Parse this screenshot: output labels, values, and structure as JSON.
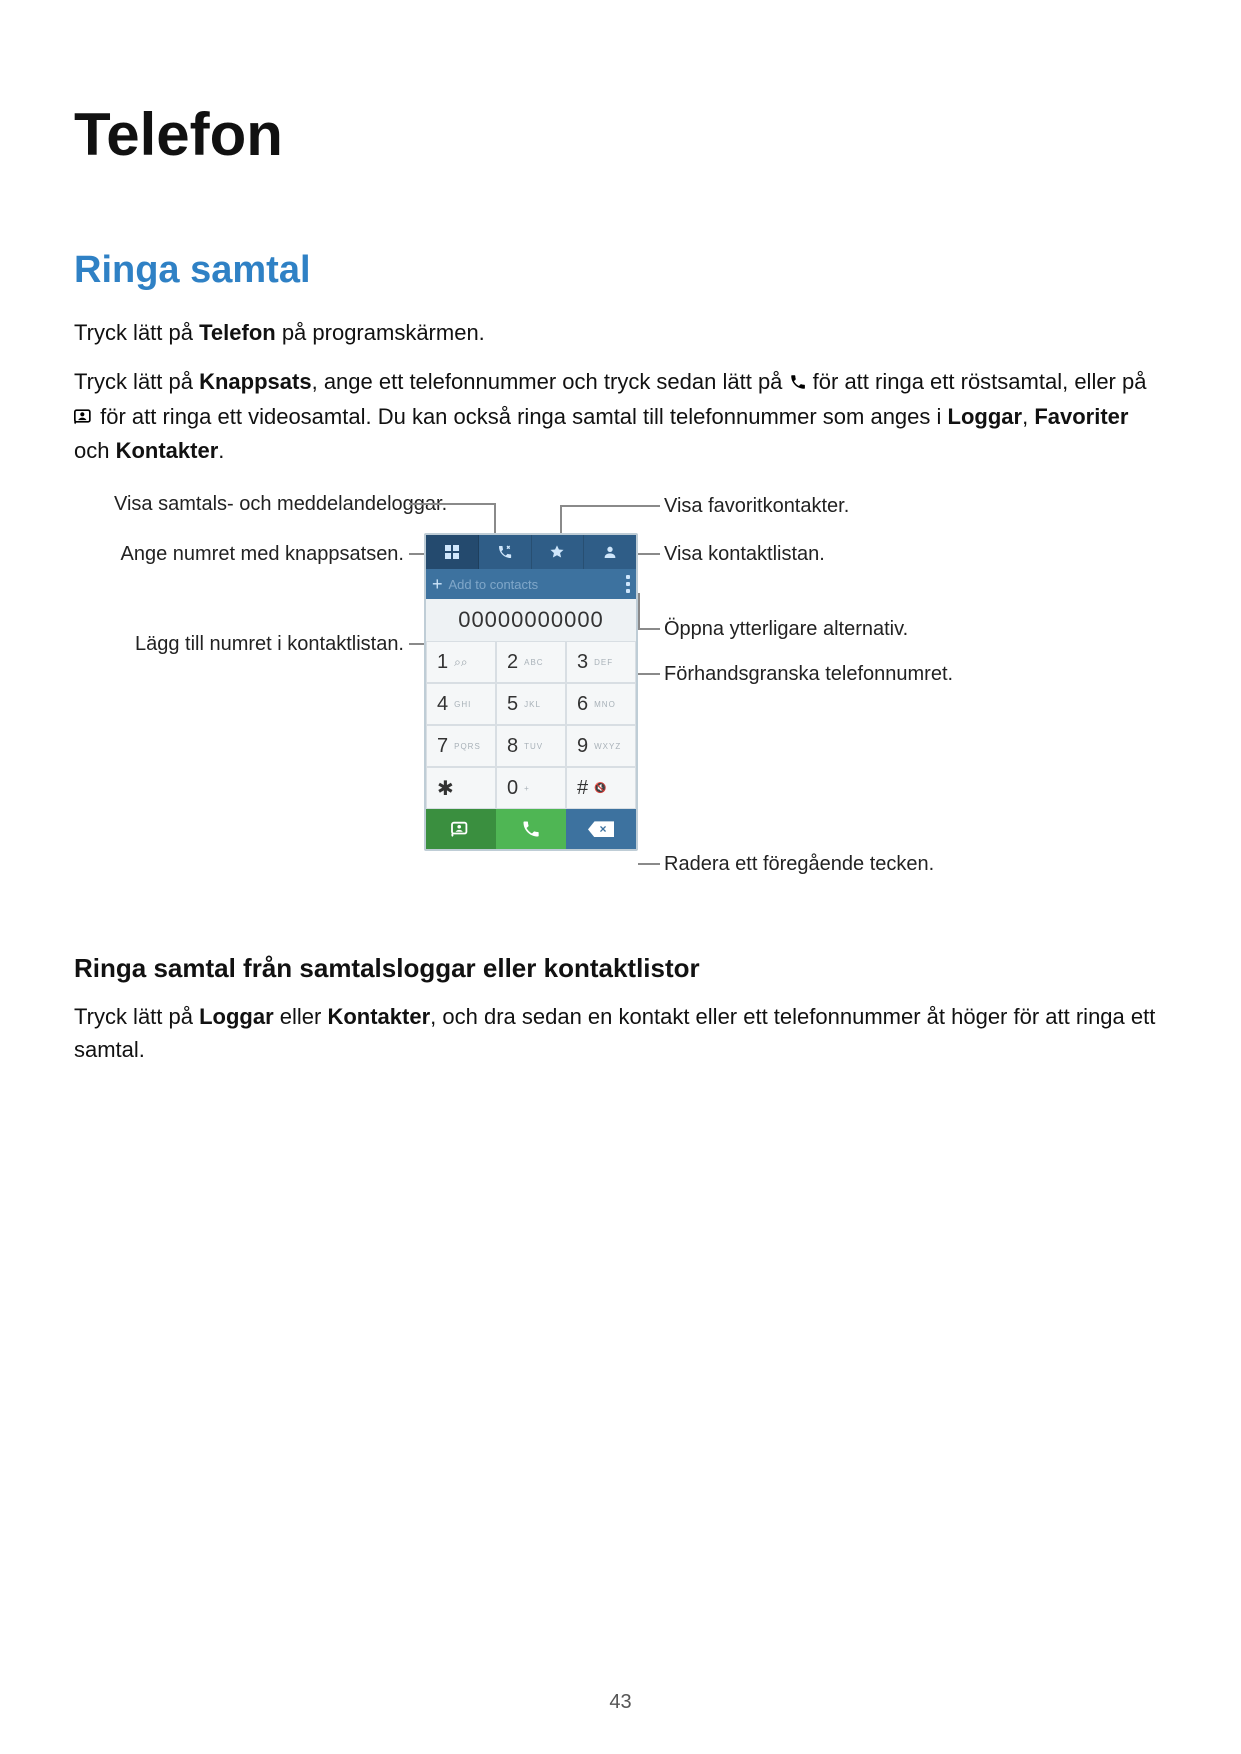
{
  "title": "Telefon",
  "section_heading": "Ringa samtal",
  "intro": {
    "line1_pre": "Tryck lätt på ",
    "line1_b": "Telefon",
    "line1_post": " på programskärmen.",
    "p2_a": "Tryck lätt på ",
    "p2_b1": "Knappsats",
    "p2_c": ", ange ett telefonnummer och tryck sedan lätt på ",
    "p2_d": " för att ringa ett röstsamtal, eller på ",
    "p2_e": " för att ringa ett videosamtal. Du kan också ringa samtal till telefonnummer som anges i ",
    "p2_b2": "Loggar",
    "p2_f": ", ",
    "p2_b3": "Favoriter",
    "p2_g": " och ",
    "p2_b4": "Kontakter",
    "p2_h": "."
  },
  "callouts": {
    "logs": "Visa samtals- och meddelandeloggar.",
    "keypad": "Ange numret med knappsatsen.",
    "add_contact": "Lägg till numret i kontaktlistan.",
    "favorites": "Visa favoritkontakter.",
    "contacts": "Visa kontaktlistan.",
    "menu": "Öppna ytterligare alternativ.",
    "preview": "Förhandsgranska telefonnumret.",
    "backspace": "Radera ett föregående tecken."
  },
  "phone": {
    "add_to_contacts": "Add to contacts",
    "number": "00000000000",
    "keys": [
      {
        "d": "1",
        "s": ""
      },
      {
        "d": "2",
        "s": "ABC"
      },
      {
        "d": "3",
        "s": "DEF"
      },
      {
        "d": "4",
        "s": "GHI"
      },
      {
        "d": "5",
        "s": "JKL"
      },
      {
        "d": "6",
        "s": "MNO"
      },
      {
        "d": "7",
        "s": "PQRS"
      },
      {
        "d": "8",
        "s": "TUV"
      },
      {
        "d": "9",
        "s": "WXYZ"
      },
      {
        "d": "✱",
        "s": ""
      },
      {
        "d": "0",
        "s": "+"
      },
      {
        "d": "#",
        "s": ""
      }
    ]
  },
  "subsection": {
    "heading": "Ringa samtal från samtalsloggar eller kontaktlistor",
    "body_a": "Tryck lätt på ",
    "body_b1": "Loggar",
    "body_b": " eller ",
    "body_b2": "Kontakter",
    "body_c": ", och dra sedan en kontakt eller ett telefonnummer åt höger för att ringa ett samtal."
  },
  "page_number": "43"
}
